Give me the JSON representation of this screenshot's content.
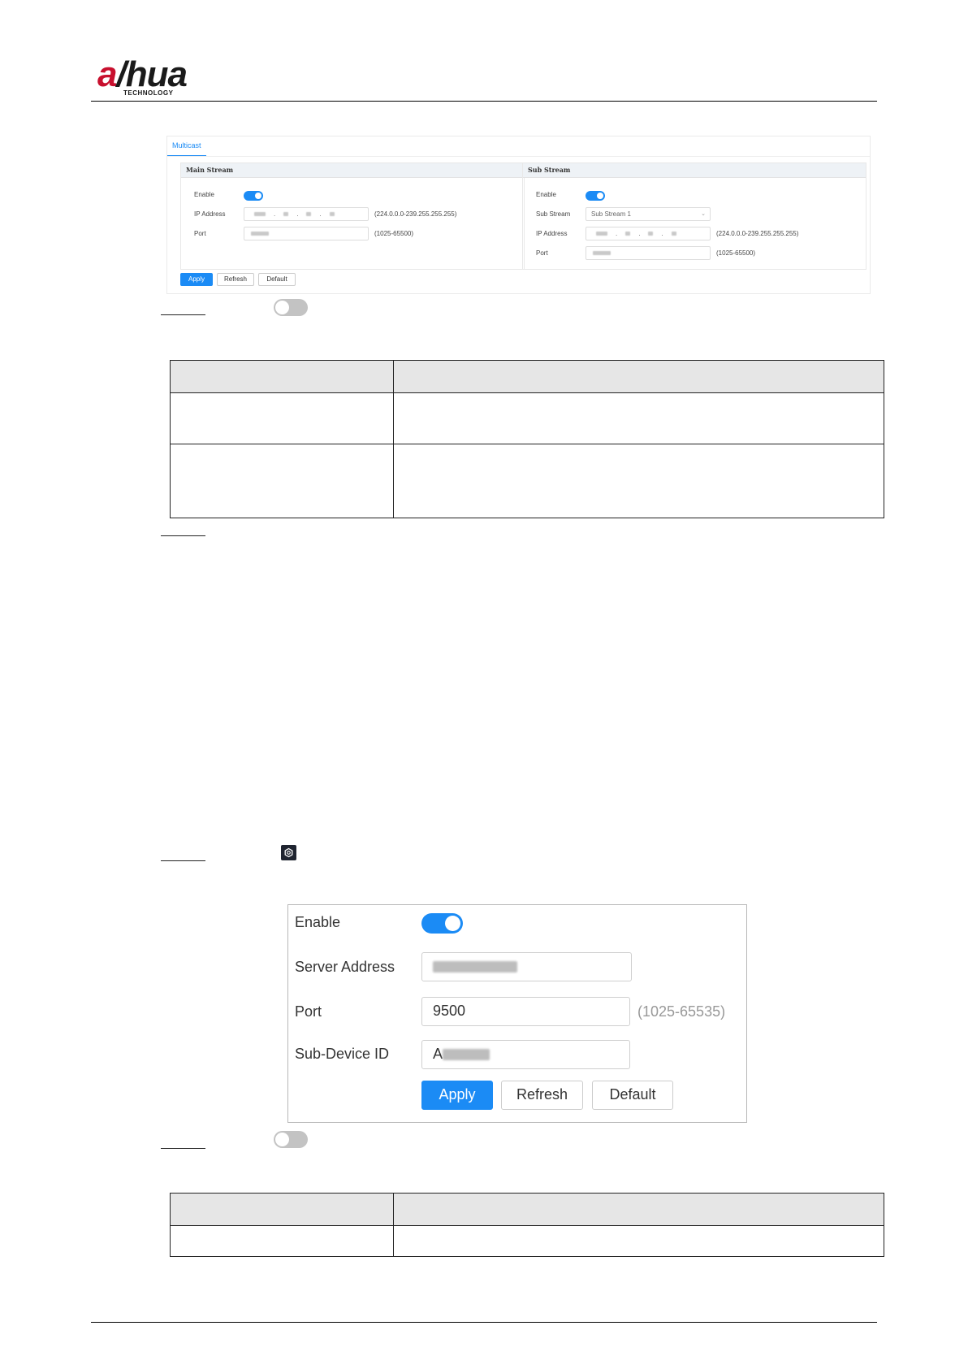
{
  "header": {
    "logo_text_a": "a",
    "logo_text_rest": "hua",
    "logo_sub": "TECHNOLOGY"
  },
  "multicast": {
    "tab_label": "Multicast",
    "main_stream": {
      "title": "Main Stream",
      "enable_label": "Enable",
      "enabled": true,
      "ip_label": "IP Address",
      "ip_range": "(224.0.0.0-239.255.255.255)",
      "port_label": "Port",
      "port_range": "(1025-65500)"
    },
    "sub_stream": {
      "title": "Sub Stream",
      "enable_label": "Enable",
      "enabled": true,
      "stream_label": "Sub Stream",
      "stream_value": "Sub Stream 1",
      "ip_label": "IP Address",
      "ip_range": "(224.0.0.0-239.255.255.255)",
      "port_label": "Port",
      "port_range": "(1025-65500)"
    },
    "buttons": {
      "apply": "Apply",
      "refresh": "Refresh",
      "default": "Default"
    }
  },
  "config": {
    "enable_label": "Enable",
    "enabled": true,
    "server_label": "Server Address",
    "port_label": "Port",
    "port_value": "9500",
    "port_range": "(1025-65535)",
    "subdevice_label": "Sub-Device ID",
    "subdevice_prefix": "A",
    "buttons": {
      "apply": "Apply",
      "refresh": "Refresh",
      "default": "Default"
    }
  },
  "colors": {
    "accent": "#1b8bf5",
    "logo_red": "#c8102e",
    "table_header": "#e6e6e6"
  }
}
